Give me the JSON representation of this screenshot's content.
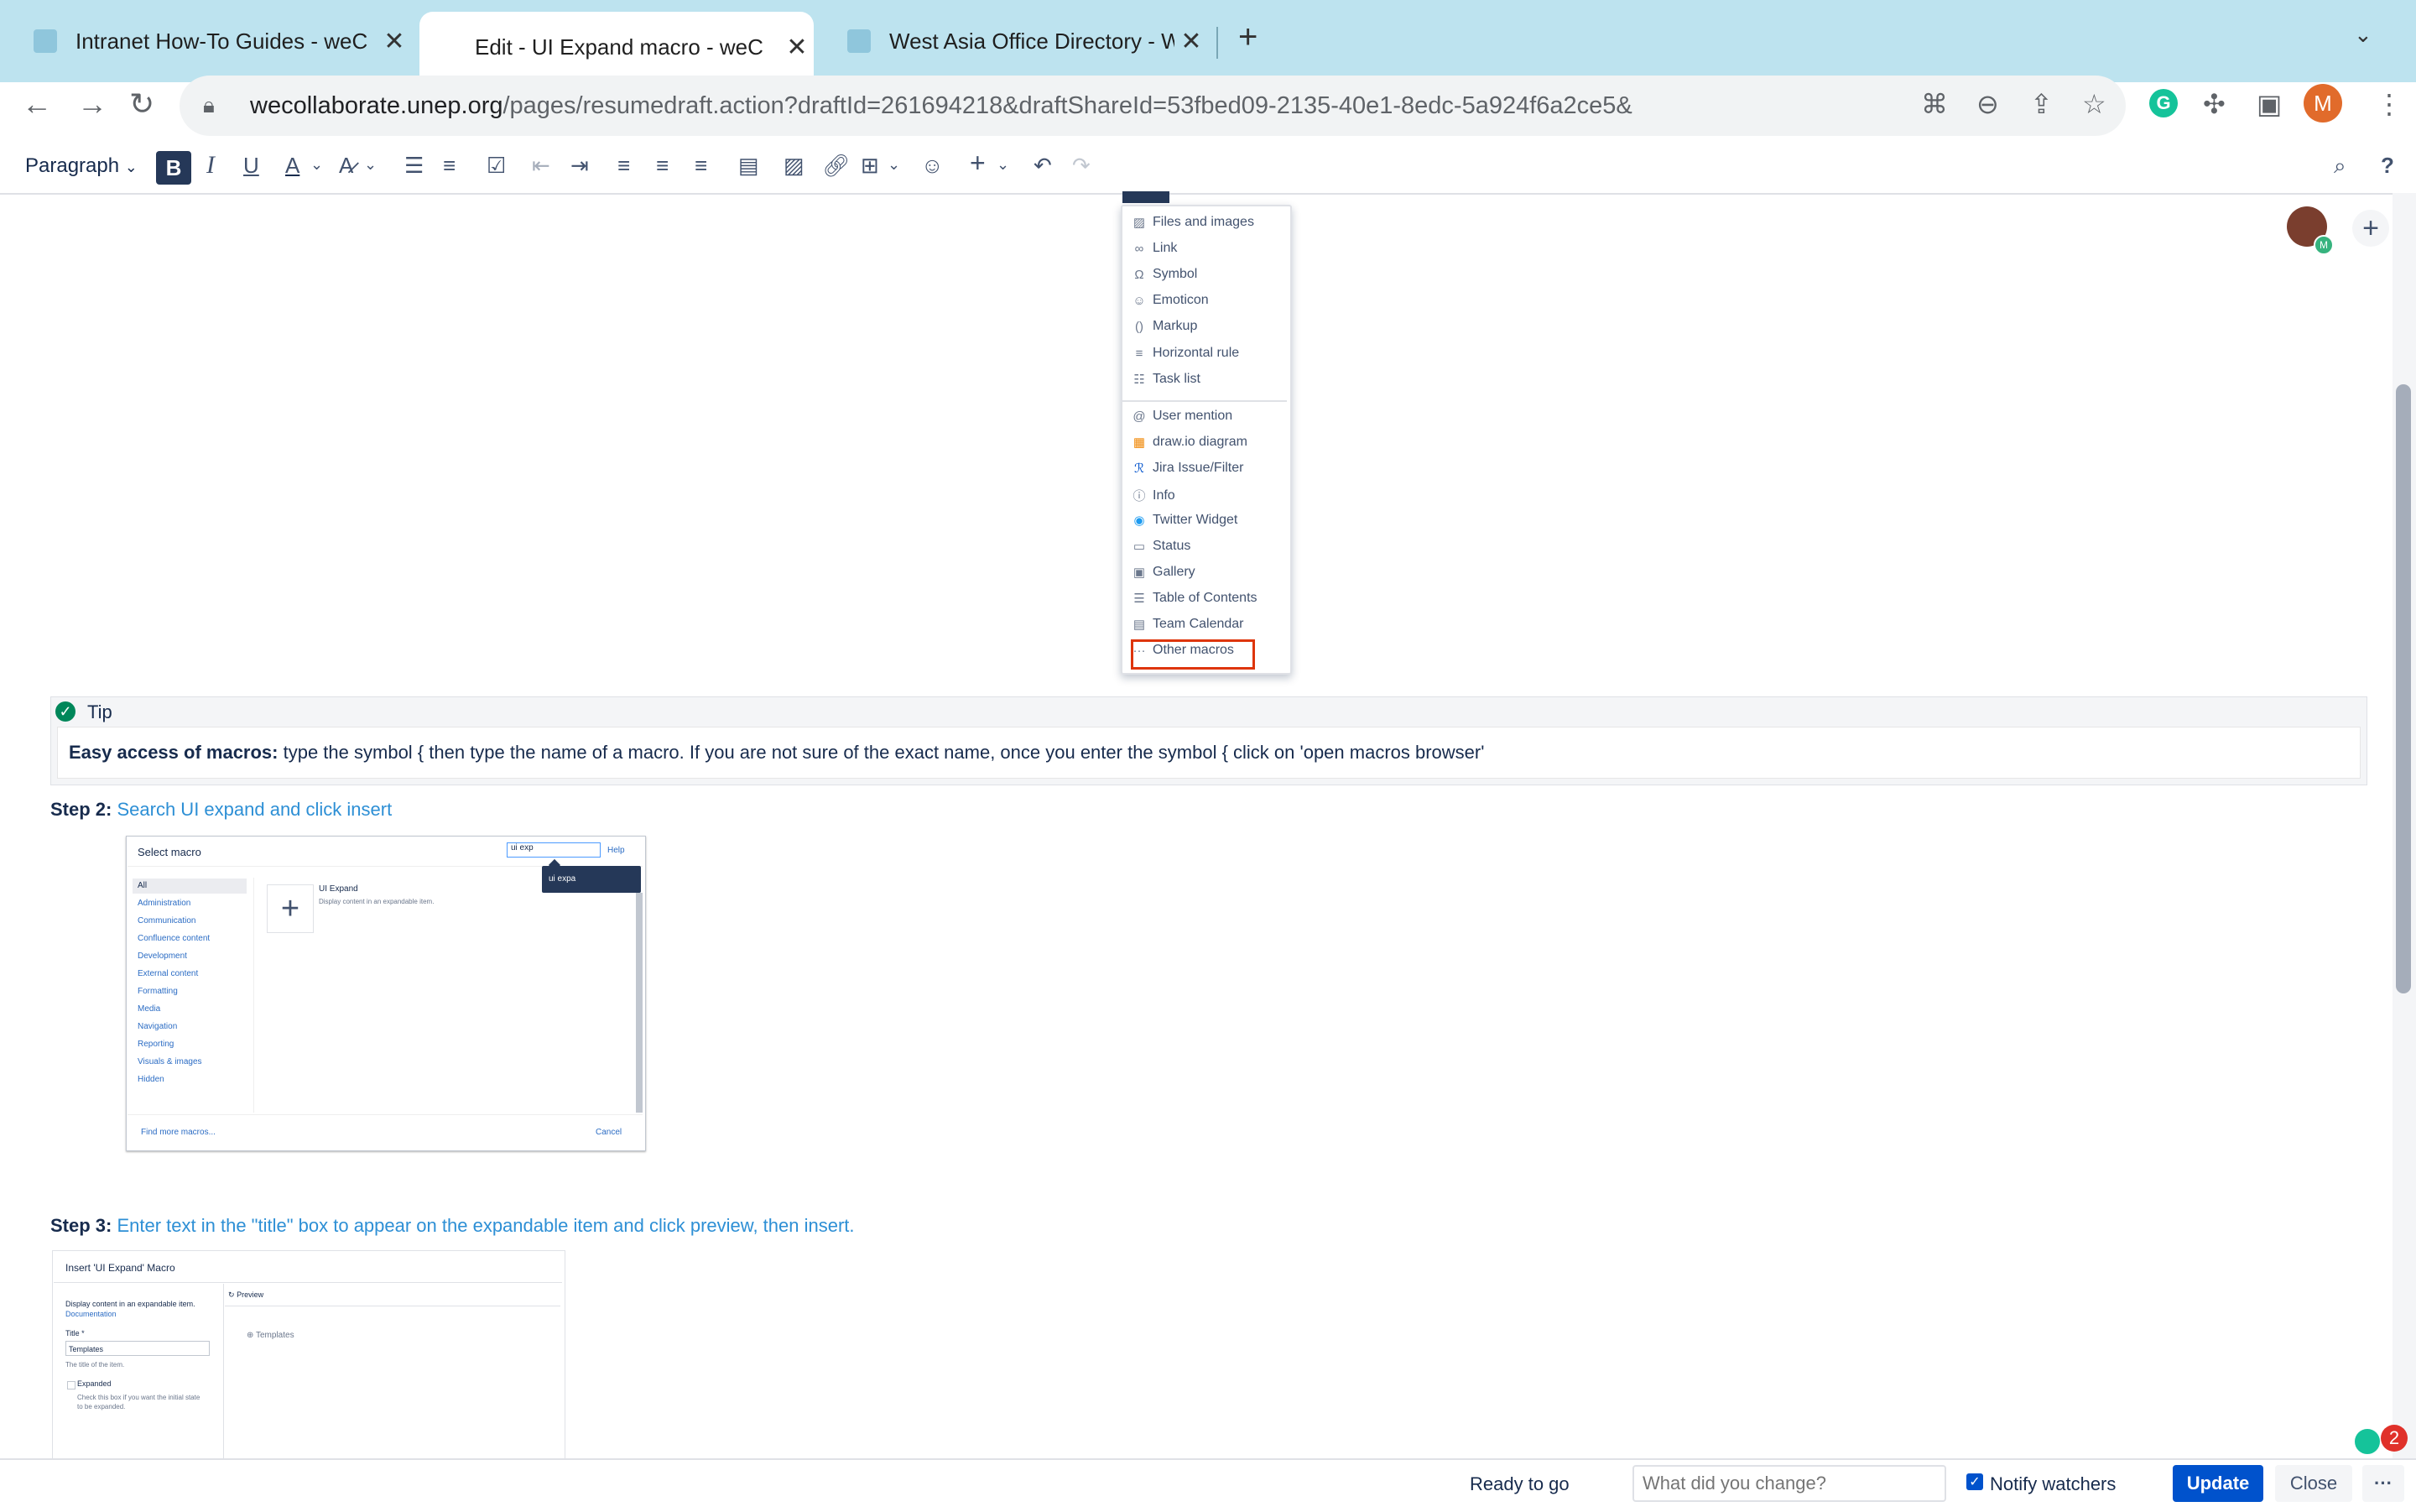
{
  "browser": {
    "tabs": [
      {
        "title": "Intranet How-To Guides - weC",
        "close": "✕"
      },
      {
        "title": "Edit - UI Expand macro - weC",
        "close": "✕"
      },
      {
        "title": "West Asia Office Directory - W",
        "close": "✕"
      }
    ],
    "new_tab": "+",
    "url_domain": "wecollaborate.unep.org",
    "url_path": "/pages/resumedraft.action?draftId=261694218&draftShareId=53fbed09-2135-40e1-8edc-5a924f6a2ce5&",
    "profile_initial": "M"
  },
  "toolbar": {
    "paragraph": "Paragraph",
    "bold": "B",
    "italic": "I",
    "underline": "U",
    "text_color": "A",
    "help": "?"
  },
  "insert_menu": {
    "group1": [
      "Files and images",
      "Link",
      "Symbol",
      "Emoticon",
      "Markup",
      "Horizontal rule",
      "Task list"
    ],
    "group2": [
      "User mention",
      "draw.io diagram",
      "Jira Issue/Filter",
      "Info",
      "Twitter Widget",
      "Status",
      "Gallery",
      "Table of Contents",
      "Team Calendar"
    ],
    "highlighted": "Other macros"
  },
  "tip": {
    "title": "Tip",
    "bold_start": "Easy access of macros:",
    "text": " type the symbol { then type the name of a macro. If you are not sure of the exact name, once you enter the symbol { click on 'open macros browser'"
  },
  "steps": [
    {
      "label": "Step 2:",
      "text": "Search UI expand and click insert"
    },
    {
      "label": "Step 3:",
      "text": "Enter text in the \"title\" box to appear on the expandable item and click preview, then insert."
    }
  ],
  "select_macro": {
    "title": "Select macro",
    "search_value": "ui exp",
    "help": "Help",
    "tooltip": "ui expa",
    "categories": [
      "All",
      "Administration",
      "Communication",
      "Confluence content",
      "Development",
      "External content",
      "Formatting",
      "Media",
      "Navigation",
      "Reporting",
      "Visuals & images",
      "Hidden"
    ],
    "macro_name": "UI Expand",
    "macro_desc": "Display content in an expandable item.",
    "find_more": "Find more macros...",
    "cancel": "Cancel"
  },
  "insert_macro": {
    "title": "Insert 'UI Expand' Macro",
    "desc": "Display content in an expandable item.",
    "doc_link": "Documentation",
    "field_label": "Title *",
    "field_value": "Templates",
    "field_hint": "The title of the item.",
    "expanded_label": "Expanded",
    "expanded_hint": "Check this box if you want the initial state to be expanded.",
    "preview_label": "Preview",
    "preview_item": "Templates"
  },
  "bottom_bar": {
    "status": "Ready to go",
    "change_placeholder": "What did you change?",
    "notify_label": "Notify watchers",
    "update": "Update",
    "close": "Close",
    "more": "···"
  },
  "colors": {
    "primary": "#0052cc",
    "link": "#2d8fd5",
    "highlight_border": "#de350b",
    "tab_bar": "#bde3ef"
  }
}
